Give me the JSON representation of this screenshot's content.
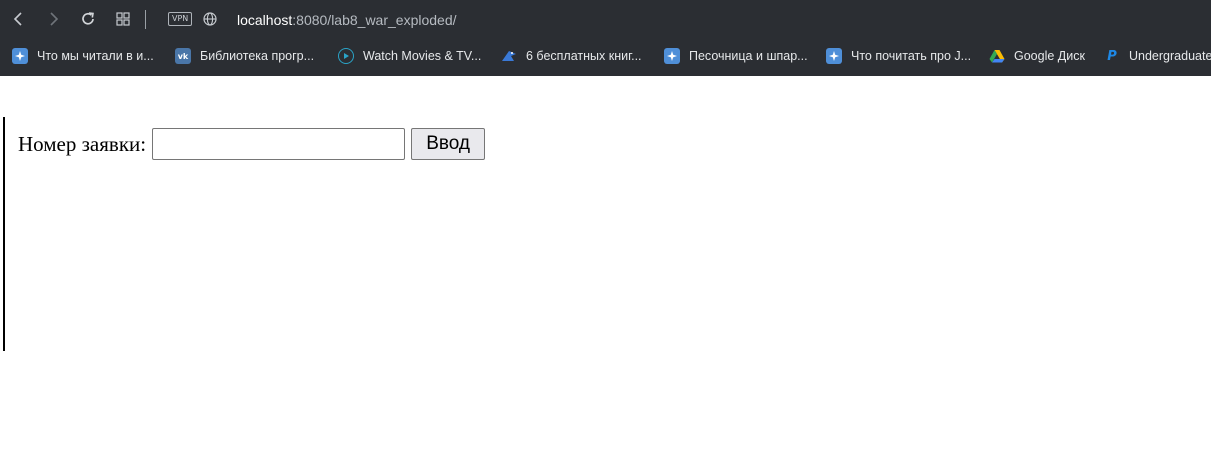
{
  "browser": {
    "vpn_label": "VPN",
    "url_host": "localhost",
    "url_rest": ":8080/lab8_war_exploded/",
    "icons": [
      "back-icon",
      "forward-icon",
      "reload-icon",
      "tabs-grid-icon",
      "vpn-icon",
      "globe-icon"
    ]
  },
  "bookmarks": [
    {
      "label": "Что мы читали в и...",
      "icon": "puzzle-icon",
      "color": "#4f8fd8"
    },
    {
      "label": "Библиотека прогр...",
      "icon": "vk-icon",
      "color": "#4a76a8"
    },
    {
      "label": "Watch Movies & TV...",
      "icon": "play-circle-icon",
      "color": "#2aa3c7"
    },
    {
      "label": "6 бесплатных книг...",
      "icon": "bird-icon",
      "color": "#3a79d6"
    },
    {
      "label": "Песочница и шпар...",
      "icon": "puzzle-icon",
      "color": "#4f8fd8"
    },
    {
      "label": "Что почитать про J...",
      "icon": "puzzle-icon",
      "color": "#4f8fd8"
    },
    {
      "label": "Google Диск",
      "icon": "google-drive-icon",
      "color": "#34a853"
    },
    {
      "label": "Undergraduate",
      "icon": "paypal-icon",
      "color": "#1565c0"
    }
  ],
  "form": {
    "label": "Номер заявки:",
    "input_value": "",
    "button_label": "Ввод"
  }
}
